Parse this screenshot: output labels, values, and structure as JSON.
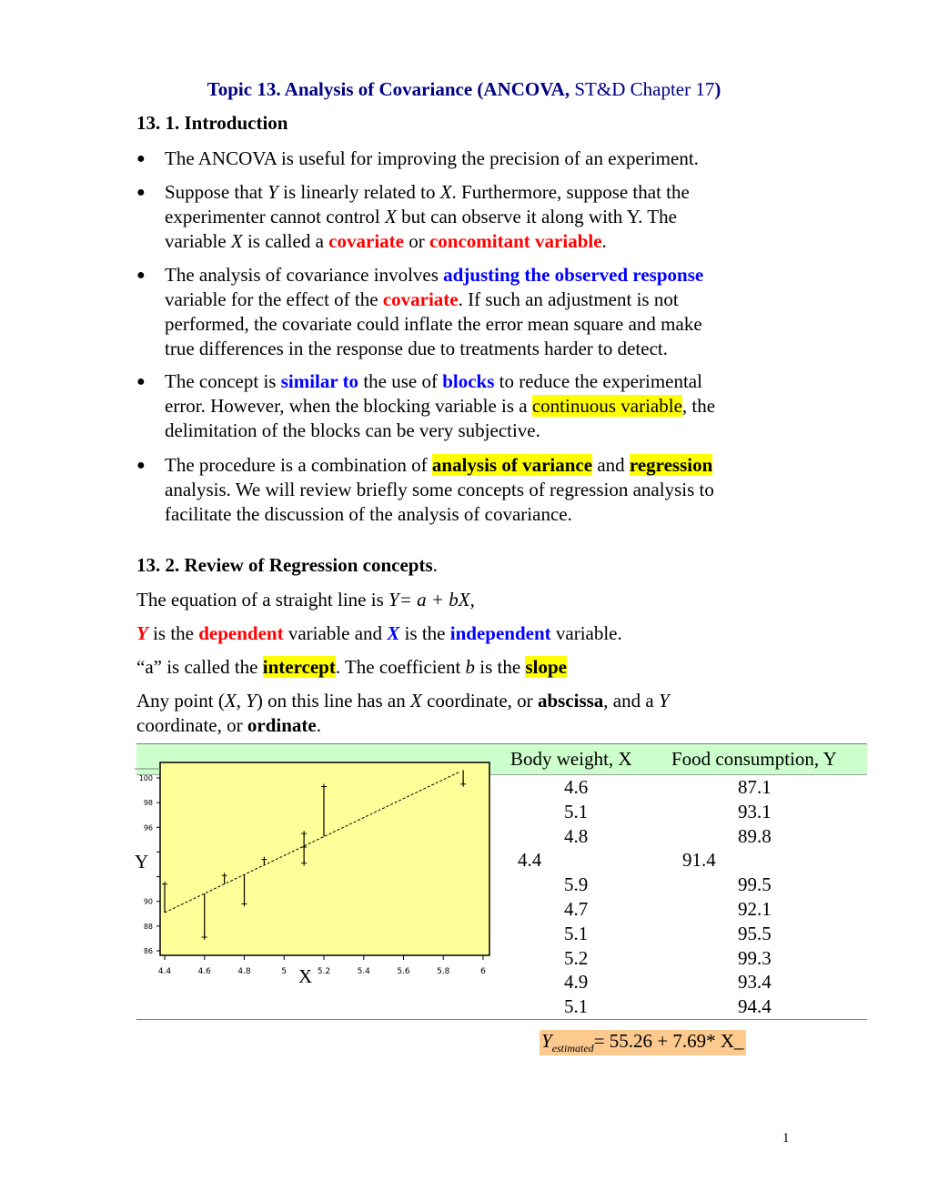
{
  "title": {
    "part1": "Topic 13.  Analysis of Covariance (ANCOVA,",
    "part2": " ST&D Chapter 17",
    "part3": ")"
  },
  "section1": {
    "heading": "13. 1. Introduction",
    "bullets": [
      {
        "text": "The ANCOVA is useful for improving the precision of an experiment."
      },
      {
        "l1a": "Suppose that ",
        "l1b": "Y",
        "l1c": " is linearly related to ",
        "l1d": "X",
        "l1e": ".  Furthermore, suppose that the",
        "l2a": "experimenter cannot control ",
        "l2b": "X",
        "l2c": " but can observe it along with Y.  The",
        "l3a": "variable ",
        "l3b": "X",
        "l3c": " is called a ",
        "l3d": "covariate",
        "l3e": " or ",
        "l3f": "concomitant variable",
        "l3g": "."
      },
      {
        "l1a": "The analysis of covariance involves ",
        "l1b": "adjusting the observed response",
        "l2a": "variable for the effect of the ",
        "l2b": "covariate",
        "l2c": ". If such an adjustment is not",
        "l3": "performed, the covariate could inflate the error mean square and make",
        "l4": "true differences in the response due to treatments harder to detect."
      },
      {
        "l1a": "The concept is ",
        "l1b": "similar to",
        "l1c": " the use of ",
        "l1d": "blocks",
        "l1e": " to reduce the experimental",
        "l2a": "error. However, when the blocking variable is a ",
        "l2b": "continuous variable",
        "l2c": ", the",
        "l3": "delimitation of the blocks can be very subjective."
      },
      {
        "l1a": "The procedure is a combination of ",
        "l1b": "analysis of variance",
        "l1c": " and ",
        "l1d": "regression",
        "l2": "analysis. We will review briefly some concepts of regression analysis to",
        "l3": "facilitate the discussion of the analysis of covariance."
      }
    ]
  },
  "section2": {
    "heading": "13. 2. Review of Regression concepts",
    "heading_dot": ".",
    "line1a": "The equation of a straight line is ",
    "line1b": "Y= a + bX,",
    "line2a": "Y",
    "line2b": " is the ",
    "line2c": "dependent",
    "line2d": " variable and ",
    "line2e": "X",
    "line2f": " is the ",
    "line2g": "independent",
    "line2h": " variable.",
    "line3a": "“a” is called the ",
    "line3b": "intercept",
    "line3c": ". The coefficient ",
    "line3d": "b",
    "line3e": " is the ",
    "line3f": "slope",
    "line4a": "Any point (",
    "line4b": "X, Y",
    "line4c": ") on this line has an ",
    "line4d": "X",
    "line4e": " coordinate, or ",
    "line4f": "abscissa",
    "line4g": ", and a ",
    "line4h": "Y",
    "line5a": "coordinate, or ",
    "line5b": "ordinate",
    "line5c": "."
  },
  "table": {
    "headers": [
      "Body weight, X",
      "Food consumption, Y"
    ],
    "rows": [
      [
        "4.6",
        "87.1"
      ],
      [
        "5.1",
        "93.1"
      ],
      [
        "4.8",
        "89.8"
      ],
      [
        "4.4",
        "91.4"
      ],
      [
        "5.9",
        "99.5"
      ],
      [
        "4.7",
        "92.1"
      ],
      [
        "5.1",
        "95.5"
      ],
      [
        "5.2",
        "99.3"
      ],
      [
        "4.9",
        "93.4"
      ],
      [
        "5.1",
        "94.4"
      ]
    ]
  },
  "equation": {
    "y": "Y",
    "sub": "estimated",
    "rest": "=  55.26  +  7.69* X",
    "tail": "_"
  },
  "page_number": "1",
  "colors": {
    "title": "#000080",
    "red": "#ff0000",
    "blue": "#0000ff",
    "highlight": "#ffff00",
    "band": "#ccffcc",
    "plot_bg": "#ffff99",
    "equation_bg": "#fcc98f"
  },
  "chart_data": {
    "type": "scatter",
    "title": "",
    "xlabel": "X",
    "ylabel": "Y",
    "xlim": [
      4.4,
      6.0
    ],
    "ylim": [
      86,
      100
    ],
    "x_ticks": [
      "4.4",
      "4.6",
      "4.8",
      "5",
      "5.2",
      "5.4",
      "5.6",
      "5.8",
      "6"
    ],
    "y_ticks": [
      "86",
      "88",
      "90",
      "92",
      "94",
      "96",
      "98",
      "100"
    ],
    "y_tick_labels_shown": [
      "86",
      "88",
      "90",
      "",
      "",
      "96",
      "98",
      "100"
    ],
    "grid": false,
    "points": [
      {
        "x": 4.6,
        "y": 87.1
      },
      {
        "x": 5.1,
        "y": 93.1
      },
      {
        "x": 4.8,
        "y": 89.8
      },
      {
        "x": 4.4,
        "y": 91.4
      },
      {
        "x": 5.9,
        "y": 99.5
      },
      {
        "x": 4.7,
        "y": 92.1
      },
      {
        "x": 5.1,
        "y": 95.5
      },
      {
        "x": 5.2,
        "y": 99.3
      },
      {
        "x": 4.9,
        "y": 93.4
      },
      {
        "x": 5.1,
        "y": 94.4
      }
    ],
    "regression": {
      "intercept": 55.26,
      "slope": 7.69,
      "style": "dashed"
    },
    "residual_lines": true
  }
}
